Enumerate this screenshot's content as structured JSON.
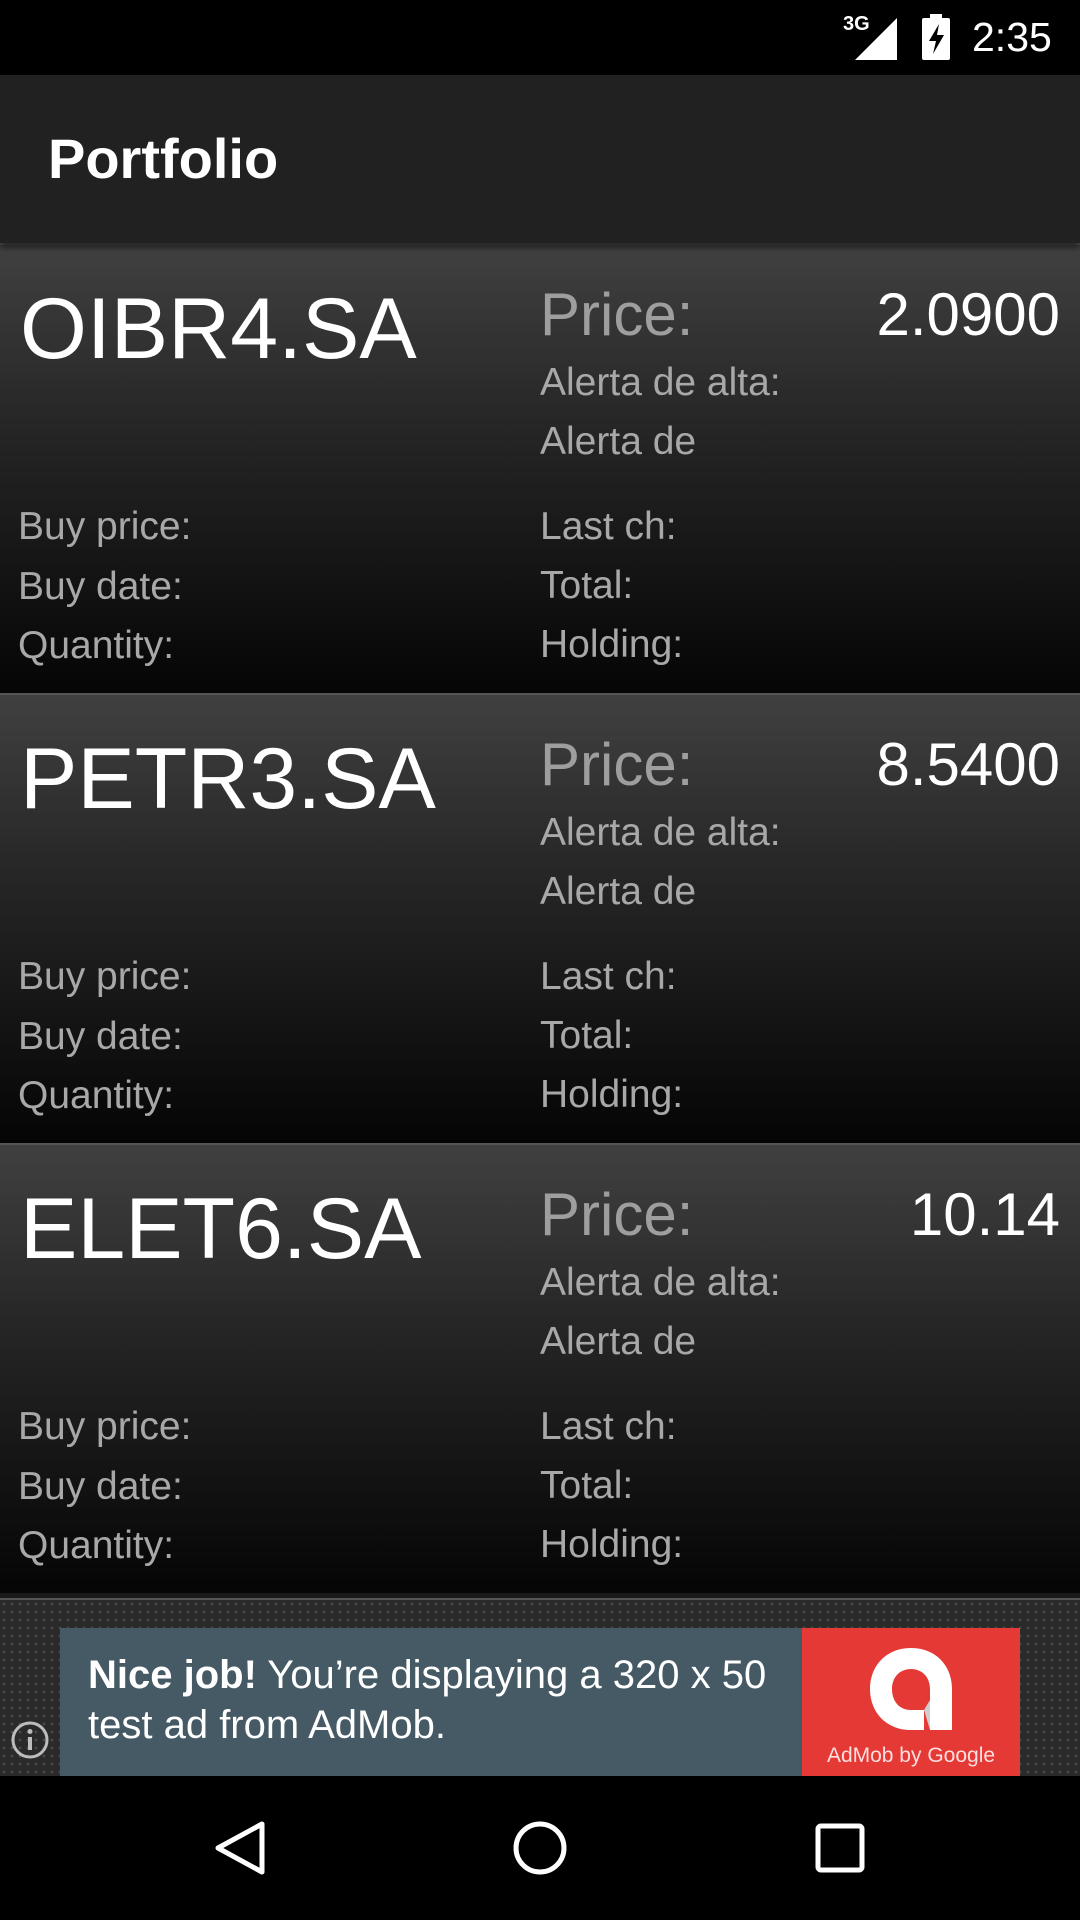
{
  "status_bar": {
    "network": "3G",
    "time": "2:35"
  },
  "app_bar": {
    "title": "Portfolio"
  },
  "labels": {
    "price": "Price:",
    "alert_high": "Alerta de alta:",
    "alert_low": "Alerta de",
    "buy_price": "Buy price:",
    "buy_date": "Buy date:",
    "quantity": "Quantity:",
    "last_change": "Last ch:",
    "total": "Total:",
    "holding": "Holding:"
  },
  "stocks": [
    {
      "symbol": "OIBR4.SA",
      "price": "2.0900"
    },
    {
      "symbol": "PETR3.SA",
      "price": "8.5400"
    },
    {
      "symbol": "ELET6.SA",
      "price": "10.14"
    }
  ],
  "ad": {
    "headline": "Nice job!",
    "body": " You’re displaying a 320 x 50 test ad from AdMob.",
    "brand_caption": "AdMob by Google",
    "brand_color": "#e53935",
    "background_color": "#455a64"
  },
  "icons": {
    "network": "signal-icon",
    "battery": "battery-charging-icon",
    "info": "info-icon",
    "back": "back-icon",
    "home": "home-icon",
    "recents": "recents-icon"
  }
}
